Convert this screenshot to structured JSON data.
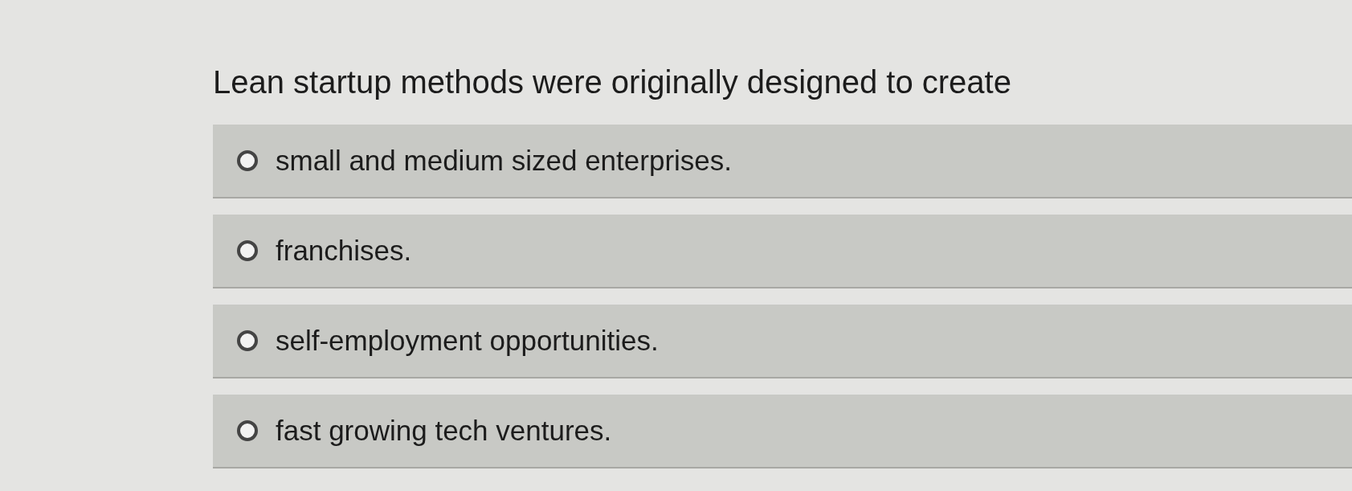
{
  "question": "Lean startup methods were originally designed to create",
  "options": [
    {
      "label": "small and medium sized enterprises.",
      "selected": false
    },
    {
      "label": "franchises.",
      "selected": false
    },
    {
      "label": "self-employment opportunities.",
      "selected": false
    },
    {
      "label": "fast growing tech ventures.",
      "selected": false
    }
  ]
}
